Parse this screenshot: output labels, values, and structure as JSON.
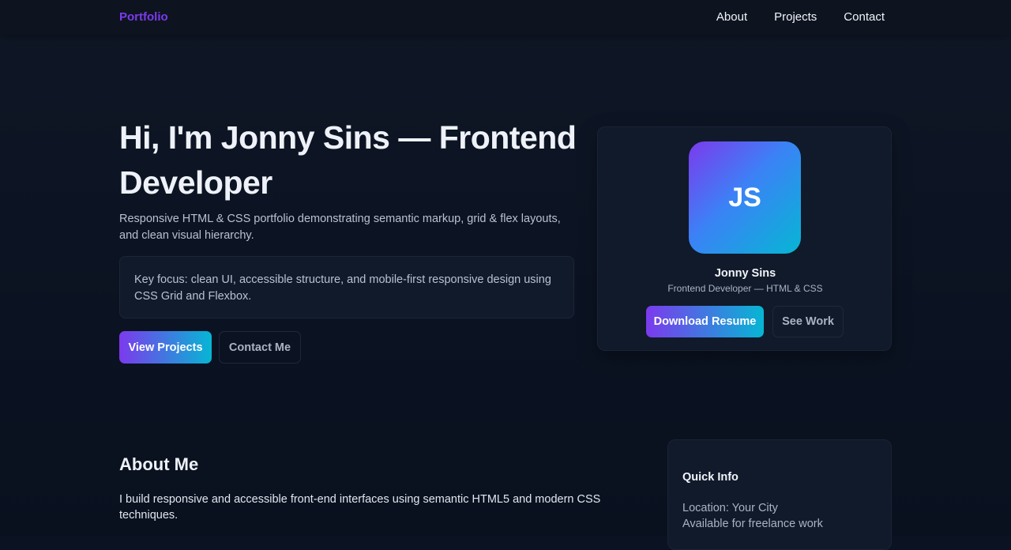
{
  "nav": {
    "brand": "Portfolio",
    "links": [
      "About",
      "Projects",
      "Contact"
    ]
  },
  "hero": {
    "title": "Hi, I'm Jonny Sins — Frontend Developer",
    "subtitle": "Responsive HTML & CSS portfolio demonstrating semantic markup, grid & flex layouts, and clean visual hierarchy.",
    "focus": "Key focus: clean UI, accessible structure, and mobile-first responsive design using CSS Grid and Flexbox.",
    "primary_button": "View Projects",
    "secondary_button": "Contact Me"
  },
  "profile": {
    "initials": "JS",
    "name": "Jonny Sins",
    "role": "Frontend Developer — HTML & CSS",
    "primary_button": "Download Resume",
    "secondary_button": "See Work"
  },
  "about": {
    "title": "About Me",
    "text": "I build responsive and accessible front-end interfaces using semantic HTML5 and modern CSS techniques."
  },
  "quick_info": {
    "title": "Quick Info",
    "location": "Location: Your City",
    "availability": "Available for freelance work"
  },
  "colors": {
    "accent_purple": "#7c3aed",
    "accent_cyan": "#06b6d4",
    "background": "#0b1322"
  }
}
